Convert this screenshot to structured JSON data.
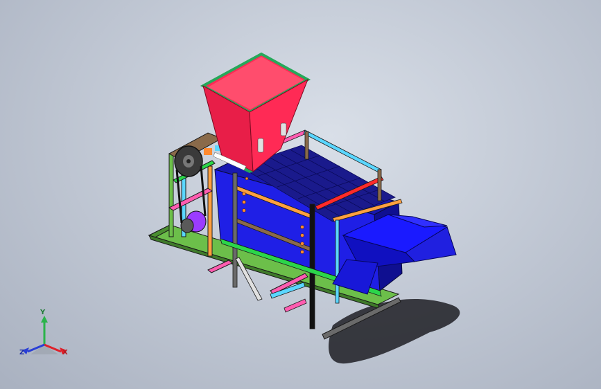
{
  "viewport": {
    "background_top": "#d9dfe8",
    "background_bottom": "#a9b1c0"
  },
  "triad": {
    "x_label": "X",
    "y_label": "Y",
    "z_label": "Z",
    "x_color": "#e0202a",
    "y_color": "#2bb34a",
    "z_color": "#2a3fd6"
  },
  "model": {
    "hopper_color": "#ff2a55",
    "hopper_rim_color": "#26a85a",
    "trough_color": "#1a1aff",
    "frame_colors": [
      "#2bd64a",
      "#ff5cb0",
      "#5ad6ff",
      "#ffa040",
      "#9b5cff"
    ],
    "screen_color": "#1a1a8c",
    "pulley_color": "#3a3a3a",
    "motor_color": "#9b3cff"
  }
}
